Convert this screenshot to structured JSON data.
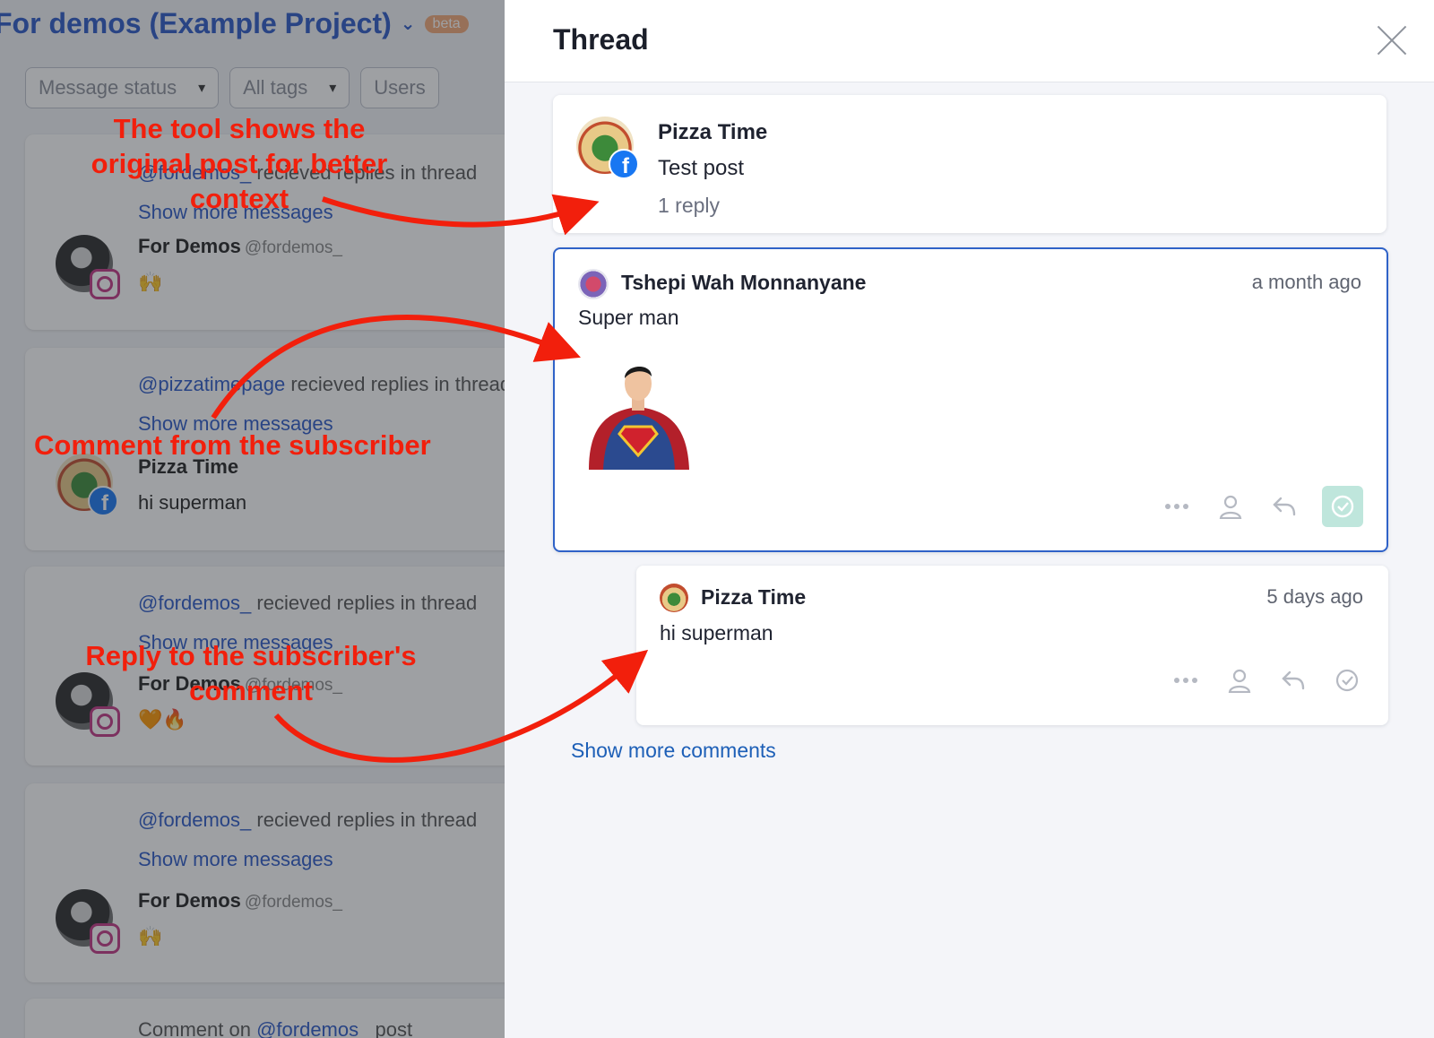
{
  "background": {
    "project_title": "For demos (Example Project)",
    "beta_badge": "beta",
    "filters": [
      "Message status",
      "All tags",
      "Users"
    ],
    "cards": [
      {
        "handle": "@fordemos_",
        "row_text": "recieved replies in thread",
        "show_more": "Show more messages",
        "author": "For Demos",
        "author_handle": "@fordemos_",
        "message": "🙌",
        "network": "instagram"
      },
      {
        "handle": "@pizzatimepage",
        "row_text": "recieved replies in thread",
        "show_more": "Show more messages",
        "author": "Pizza Time",
        "author_handle": "",
        "message": "hi superman",
        "network": "facebook"
      },
      {
        "handle": "@fordemos_",
        "row_text": "recieved replies in thread",
        "show_more": "Show more messages",
        "author": "For Demos",
        "author_handle": "@fordemos_",
        "message": "🧡🔥",
        "network": "instagram"
      },
      {
        "handle": "@fordemos_",
        "row_text": "recieved replies in thread",
        "show_more": "Show more messages",
        "author": "For Demos",
        "author_handle": "@fordemos_",
        "message": "🙌",
        "network": "instagram"
      }
    ],
    "last_card": {
      "prefix": "Comment on",
      "handle": "@fordemos_",
      "suffix": "post"
    }
  },
  "annotations": {
    "original_post": [
      "The tool shows the",
      "original post for better",
      "context"
    ],
    "subscriber_comment": "Comment from the subscriber",
    "reply": [
      "Reply to the subscriber's",
      "comment"
    ]
  },
  "thread": {
    "title": "Thread",
    "post": {
      "author": "Pizza Time",
      "text": "Test post",
      "replies": "1 reply",
      "network": "facebook"
    },
    "comment": {
      "author": "Tshepi Wah Monnanyane",
      "time": "a month ago",
      "text": "Super man",
      "attachment": "superman-image"
    },
    "reply": {
      "author": "Pizza Time",
      "time": "5 days ago",
      "text": "hi superman"
    },
    "show_more_comments": "Show more comments",
    "colors": {
      "accent": "#2f62c8",
      "link": "#1d5fb7",
      "annotation": "#f21f0c",
      "resolved": "#bfe6dc"
    }
  }
}
